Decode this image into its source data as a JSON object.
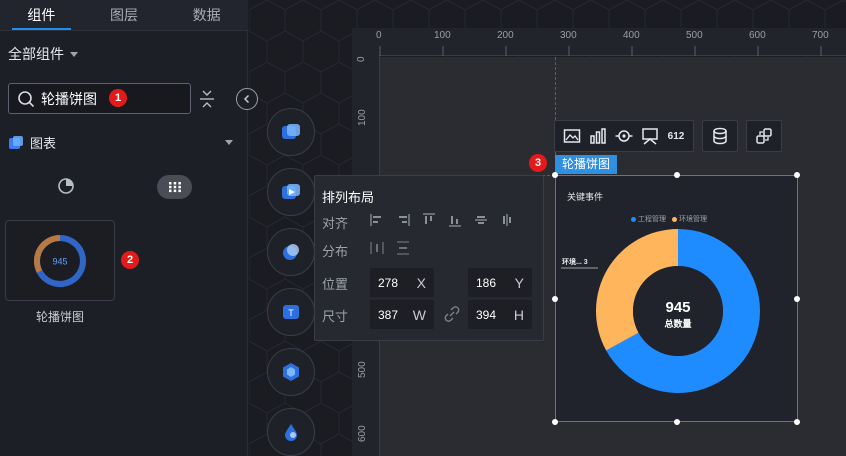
{
  "tabs": [
    {
      "label": "组件",
      "active": true
    },
    {
      "label": "图层",
      "active": false
    },
    {
      "label": "数据",
      "active": false
    }
  ],
  "all_components_label": "全部组件",
  "search": {
    "value": "轮播饼图"
  },
  "badges": {
    "b1": "1",
    "b2": "2",
    "b3": "3"
  },
  "category": {
    "label": "图表"
  },
  "thumbnail": {
    "value": "945",
    "label": "轮播饼图"
  },
  "ruler": {
    "top": [
      "0",
      "100",
      "200",
      "300",
      "400",
      "500",
      "600",
      "700"
    ],
    "left": [
      "0",
      "100",
      "500",
      "600"
    ]
  },
  "toolbar": {
    "number_label": "612"
  },
  "selected_label": "轮播饼图",
  "arrange_panel": {
    "title": "排列布局",
    "align_label": "对齐",
    "distribute_label": "分布",
    "position_label": "位置",
    "size_label": "尺寸",
    "x": "278",
    "x_unit": "X",
    "y": "186",
    "y_unit": "Y",
    "w": "387",
    "w_unit": "W",
    "h": "394",
    "h_unit": "H"
  },
  "component": {
    "title": "关键事件",
    "legend": [
      "工程管理",
      "环境管理"
    ],
    "side_label": "环境...",
    "side_value": "3",
    "center_value": "945",
    "center_label": "总数量"
  },
  "chart_data": {
    "type": "pie",
    "title": "关键事件",
    "categories": [
      "工程管理",
      "环境管理"
    ],
    "values": [
      67,
      33
    ],
    "colors": [
      "#1e8cff",
      "#ffb55c"
    ],
    "center_value": "945",
    "center_label": "总数量",
    "legend": "top"
  },
  "colors": {
    "accent": "#1f8ef1",
    "badge": "#e41a1a",
    "selection": "#2f8fe0"
  }
}
